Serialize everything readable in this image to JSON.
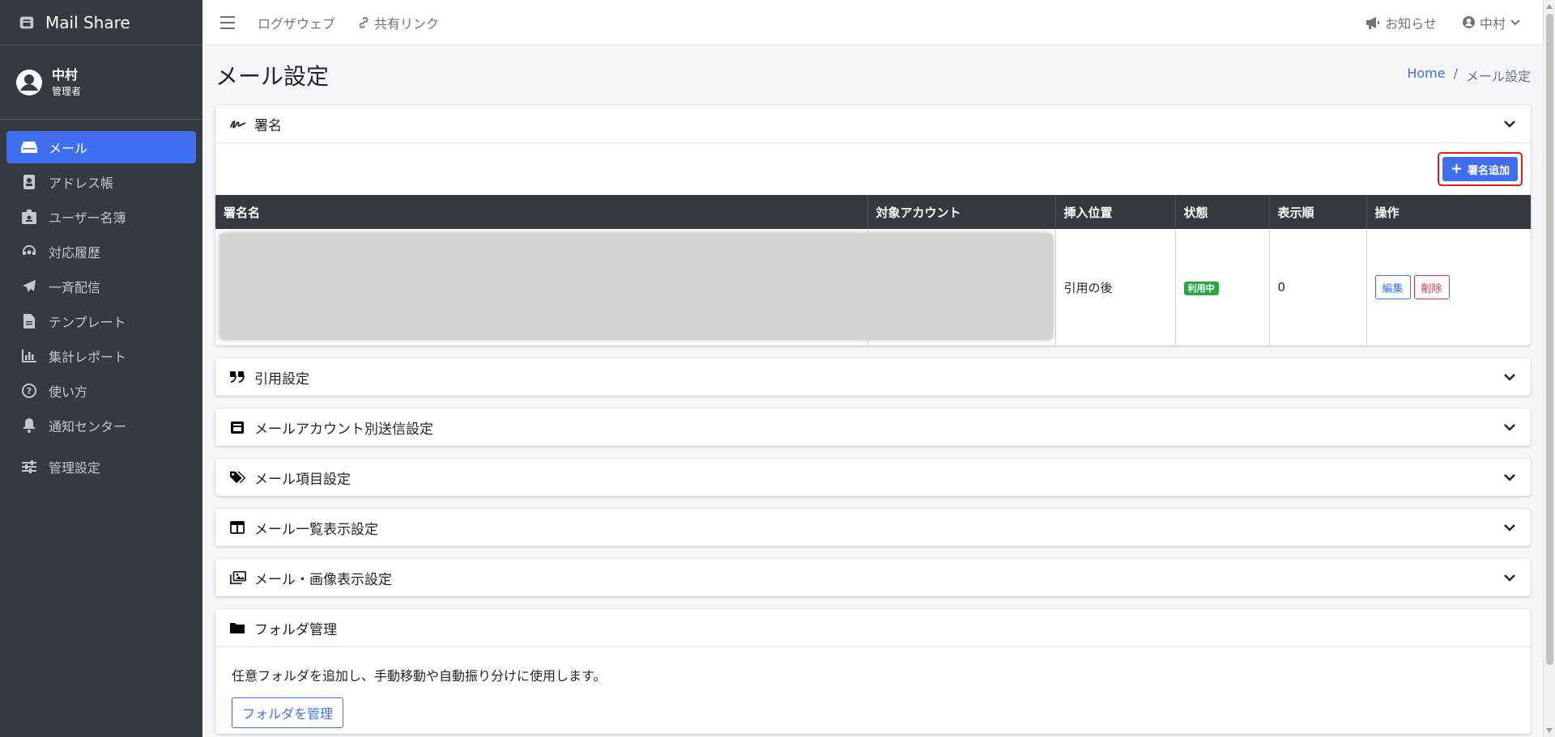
{
  "brand": {
    "name": "Mail Share",
    "icon": "mailbox-icon"
  },
  "user": {
    "name": "中村",
    "role": "管理者"
  },
  "sidebar": {
    "items": [
      {
        "label": "メール",
        "icon": "inbox-icon",
        "active": true
      },
      {
        "label": "アドレス帳",
        "icon": "address-book-icon"
      },
      {
        "label": "ユーザー名簿",
        "icon": "id-badge-icon"
      },
      {
        "label": "対応履歴",
        "icon": "headset-icon"
      },
      {
        "label": "一斉配信",
        "icon": "paper-plane-icon"
      },
      {
        "label": "テンプレート",
        "icon": "file-icon"
      },
      {
        "label": "集計レポート",
        "icon": "chart-icon"
      },
      {
        "label": "使い方",
        "icon": "question-icon"
      },
      {
        "label": "通知センター",
        "icon": "bell-icon"
      },
      {
        "label": "管理設定",
        "icon": "sliders-icon"
      }
    ]
  },
  "topbar": {
    "links": [
      {
        "label": "ログザウェブ"
      },
      {
        "label": "共有リンク",
        "icon": "link-icon"
      }
    ],
    "notice": "お知らせ",
    "user": "中村"
  },
  "page": {
    "title": "メール設定",
    "breadcrumb": {
      "home": "Home",
      "current": "メール設定"
    }
  },
  "signature": {
    "header": "署名",
    "add_button": "署名追加",
    "columns": [
      "署名名",
      "対象アカウント",
      "挿入位置",
      "状態",
      "表示順",
      "操作"
    ],
    "rows": [
      {
        "name": "",
        "account": "",
        "position": "引用の後",
        "status": "利用中",
        "order": "0",
        "edit": "編集",
        "delete": "削除"
      }
    ]
  },
  "sections": [
    {
      "label": "引用設定",
      "icon": "quote-icon"
    },
    {
      "label": "メールアカウント別送信設定",
      "icon": "mailbox-icon"
    },
    {
      "label": "メール項目設定",
      "icon": "tags-icon"
    },
    {
      "label": "メール一覧表示設定",
      "icon": "columns-icon"
    },
    {
      "label": "メール・画像表示設定",
      "icon": "images-icon"
    }
  ],
  "folder": {
    "header": "フォルダ管理",
    "description": "任意フォルダを追加し、手動移動や自動振り分けに使用します。",
    "button": "フォルダを管理"
  },
  "colors": {
    "sidebar": "#343a40",
    "accent": "#3f6ef0",
    "success": "#28a745",
    "danger": "#dc3545",
    "highlight": "#e02020"
  }
}
